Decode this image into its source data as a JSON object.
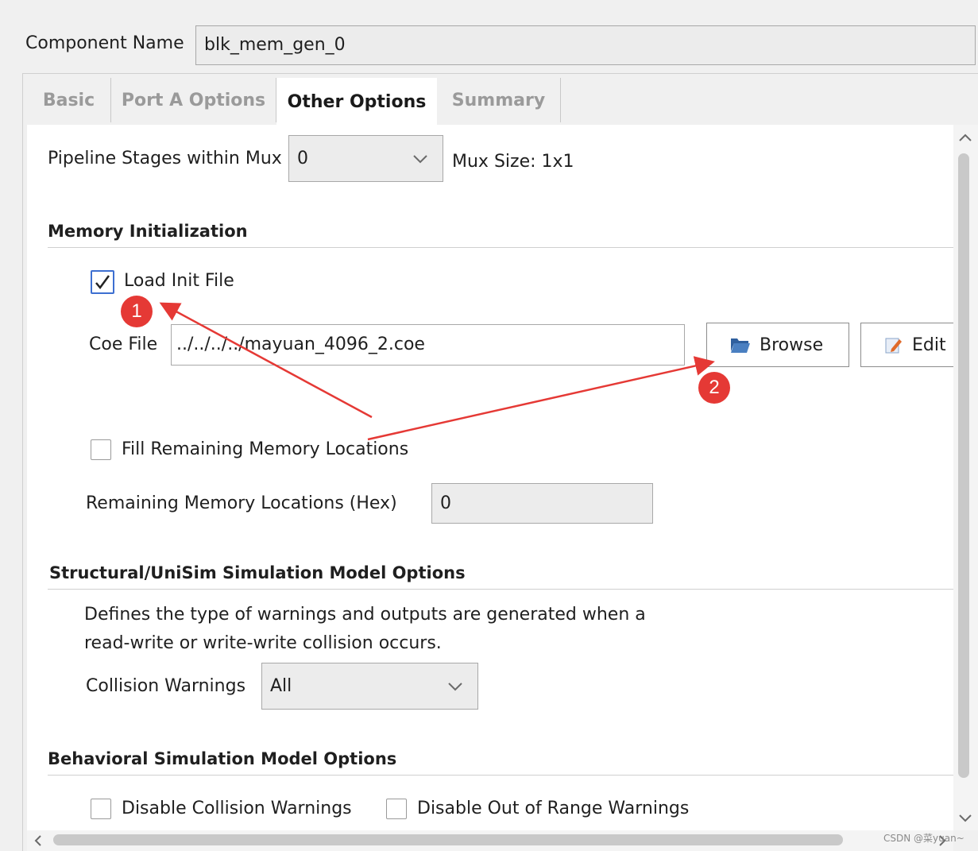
{
  "component": {
    "label": "Component Name",
    "value": "blk_mem_gen_0"
  },
  "tabs": [
    {
      "label": "Basic",
      "active": false
    },
    {
      "label": "Port A Options",
      "active": false
    },
    {
      "label": "Other Options",
      "active": true
    },
    {
      "label": "Summary",
      "active": false
    }
  ],
  "pipeline": {
    "label": "Pipeline Stages within Mux",
    "value": "0",
    "mux_size": "Mux Size: 1x1"
  },
  "memory_init": {
    "title": "Memory Initialization",
    "load_init_file": {
      "label": "Load Init File",
      "checked": true
    },
    "coe_file": {
      "label": "Coe File",
      "value": "../../../../mayuan_4096_2.coe"
    },
    "browse_label": "Browse",
    "edit_label": "Edit",
    "fill_remaining": {
      "label": "Fill Remaining Memory Locations",
      "checked": false
    },
    "remaining": {
      "label": "Remaining Memory Locations (Hex)",
      "value": "0"
    }
  },
  "structural": {
    "title": "Structural/UniSim Simulation Model Options",
    "desc_line1": "Defines the type of warnings and outputs are generated when a",
    "desc_line2": "read-write or write-write collision occurs.",
    "collision_label": "Collision Warnings",
    "collision_value": "All"
  },
  "behavioral": {
    "title": "Behavioral Simulation Model Options",
    "disable_collision": {
      "label": "Disable Collision Warnings",
      "checked": false
    },
    "disable_out_of_range": {
      "label": "Disable Out of Range Warnings",
      "checked": false
    }
  },
  "annotations": {
    "marker1": "1",
    "marker2": "2",
    "accent": "#e53935"
  },
  "watermark": "CSDN @菜yuan~",
  "icons": [
    "chevron-down-icon",
    "folder-open-icon",
    "edit-icon",
    "scroll-up-icon",
    "scroll-down-icon",
    "scroll-left-icon",
    "scroll-right-icon"
  ]
}
